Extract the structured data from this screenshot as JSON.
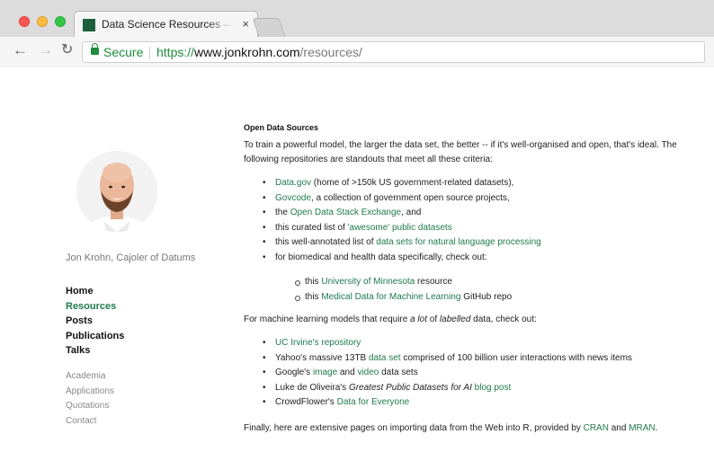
{
  "browser": {
    "tab_title": "Data Science Resources — Jon Krohn",
    "tab_close": "×",
    "secure_label": "Secure",
    "url_scheme": "https://",
    "url_host": "www.jonkrohn.com",
    "url_path": "/resources/"
  },
  "colors": {
    "link": "#1f7a4d",
    "secure": "#1e8c3b",
    "muted": "#888888"
  },
  "sidebar": {
    "author": "Jon Krohn, Cajoler of Datums",
    "nav": [
      {
        "label": "Home",
        "active": false
      },
      {
        "label": "Resources",
        "active": true
      },
      {
        "label": "Posts",
        "active": false
      },
      {
        "label": "Publications",
        "active": false
      },
      {
        "label": "Talks",
        "active": false
      }
    ],
    "subnav": [
      "Academia",
      "Applications",
      "Quotations",
      "Contact"
    ]
  },
  "content": {
    "heading": "Open Data Sources",
    "intro_line1": "To train a powerful model, the larger the data set, the better -- if it's well-organised and open, that's ideal. The",
    "intro_line2": "following repositories are standouts that meet all these criteria:",
    "sources": {
      "item1_link": "Data.gov",
      "item1_rest": " (home of >150k US government-related datasets),",
      "item2_link": "Govcode",
      "item2_rest": ", a collection of government open source projects,",
      "item3_pre": "the ",
      "item3_link": "Open Data Stack Exchange",
      "item3_rest": ", and",
      "item4_pre": "this curated list of ",
      "item4_link": "'awesome' public datasets",
      "item5_pre": "this well-annotated list of ",
      "item5_link": "data sets for natural language processing",
      "item6_text": "for biomedical and health data specifically, check out:"
    },
    "bio": {
      "item1_pre": "this ",
      "item1_link": "University of Minnesota",
      "item1_rest": " resource",
      "item2_pre": "this ",
      "item2_link": "Medical Data for Machine Learning",
      "item2_rest": " GitHub repo"
    },
    "ml_intro_pre": "For machine learning models that require ",
    "ml_intro_em1": "a lot",
    "ml_intro_mid": " of ",
    "ml_intro_em2": "labelled",
    "ml_intro_rest": " data, check out:",
    "ml": {
      "item1_link": "UC Irvine's repository",
      "item2_pre": "Yahoo's massive 13TB ",
      "item2_link": "data set",
      "item2_rest": " comprised of 100 billion user interactions with news items",
      "item3_pre": "Google's ",
      "item3_link1": "image",
      "item3_mid": " and ",
      "item3_link2": "video",
      "item3_rest": " data sets",
      "item4_pre": "Luke de Oliveira's ",
      "item4_em": "Greatest Public Datasets for AI",
      "item4_mid": " ",
      "item4_link": "blog post",
      "item5_pre": "CrowdFlower's ",
      "item5_link": "Data for Everyone"
    },
    "closing_pre": "Finally, here are extensive pages on importing data from the Web into R, provided by ",
    "closing_link1": "CRAN",
    "closing_mid": " and ",
    "closing_link2": "MRAN",
    "closing_end": "."
  }
}
